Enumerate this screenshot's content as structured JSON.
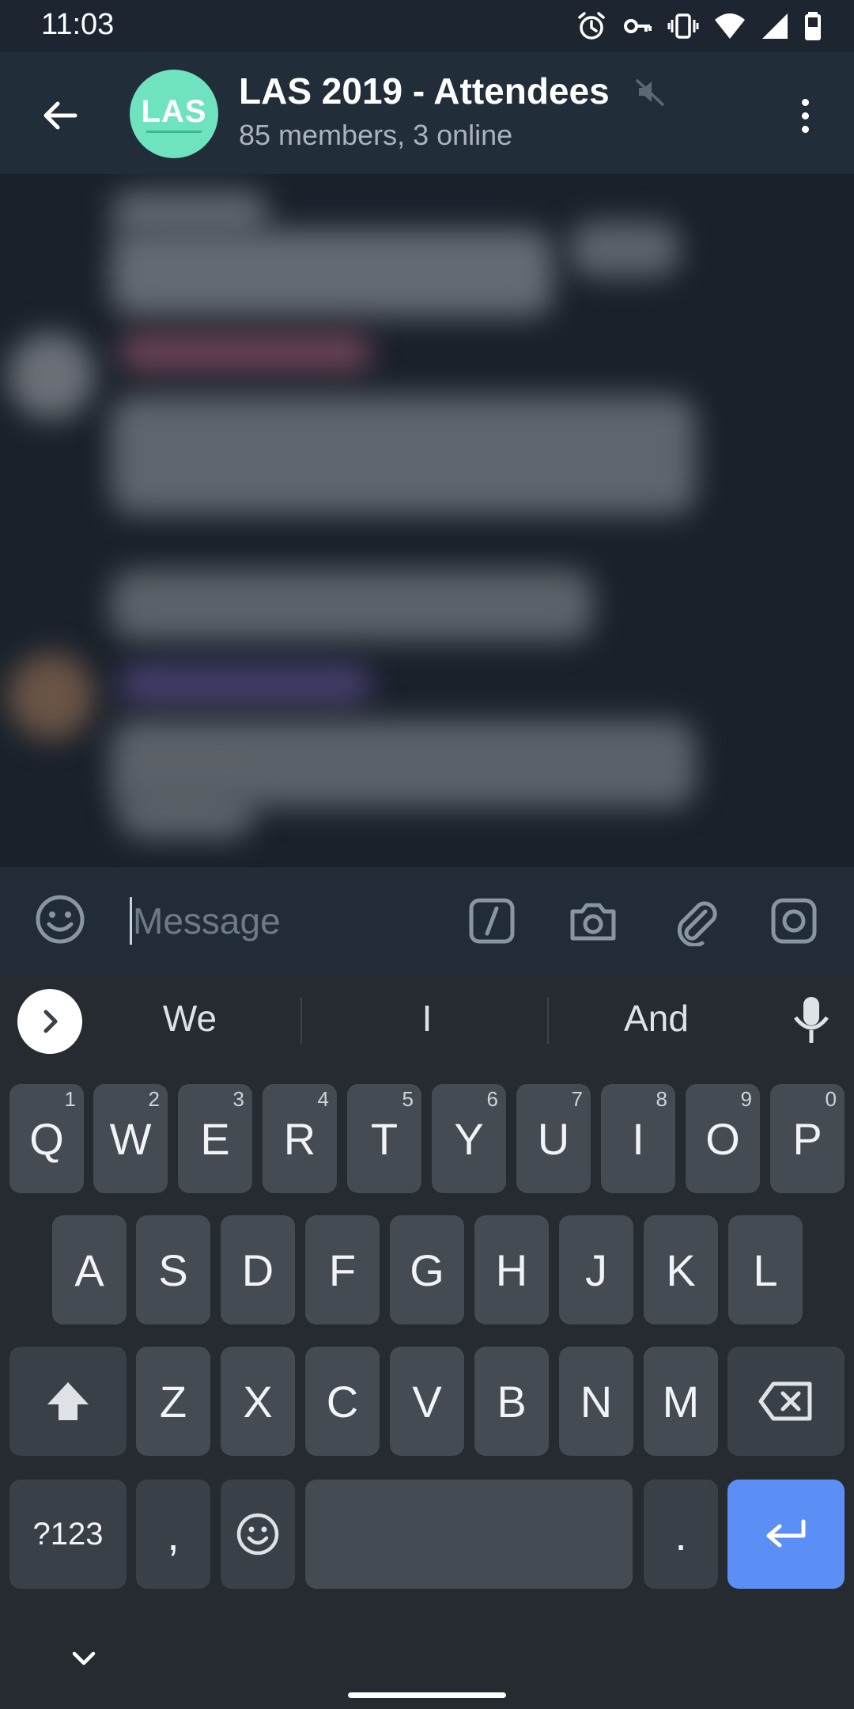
{
  "status_bar": {
    "time": "11:03",
    "icons": [
      "alarm-icon",
      "vpn-key-icon",
      "vibrate-icon",
      "wifi-icon",
      "signal-icon",
      "battery-icon"
    ]
  },
  "header": {
    "avatar_text": "LAS",
    "title": "LAS 2019 - Attendees",
    "subtitle": "85 members, 3 online",
    "accent_color": "#6fe3bf"
  },
  "input_bar": {
    "placeholder": "Message",
    "value": ""
  },
  "keyboard": {
    "suggestions": [
      "We",
      "I",
      "And"
    ],
    "row1": [
      {
        "label": "Q",
        "hint": "1"
      },
      {
        "label": "W",
        "hint": "2"
      },
      {
        "label": "E",
        "hint": "3"
      },
      {
        "label": "R",
        "hint": "4"
      },
      {
        "label": "T",
        "hint": "5"
      },
      {
        "label": "Y",
        "hint": "6"
      },
      {
        "label": "U",
        "hint": "7"
      },
      {
        "label": "I",
        "hint": "8"
      },
      {
        "label": "O",
        "hint": "9"
      },
      {
        "label": "P",
        "hint": "0"
      }
    ],
    "row2": [
      "A",
      "S",
      "D",
      "F",
      "G",
      "H",
      "J",
      "K",
      "L"
    ],
    "row3": [
      "Z",
      "X",
      "C",
      "V",
      "B",
      "N",
      "M"
    ],
    "symbols_label": "?123",
    "comma_label": ",",
    "period_label": ".",
    "enter_color": "#5b8ff5"
  }
}
